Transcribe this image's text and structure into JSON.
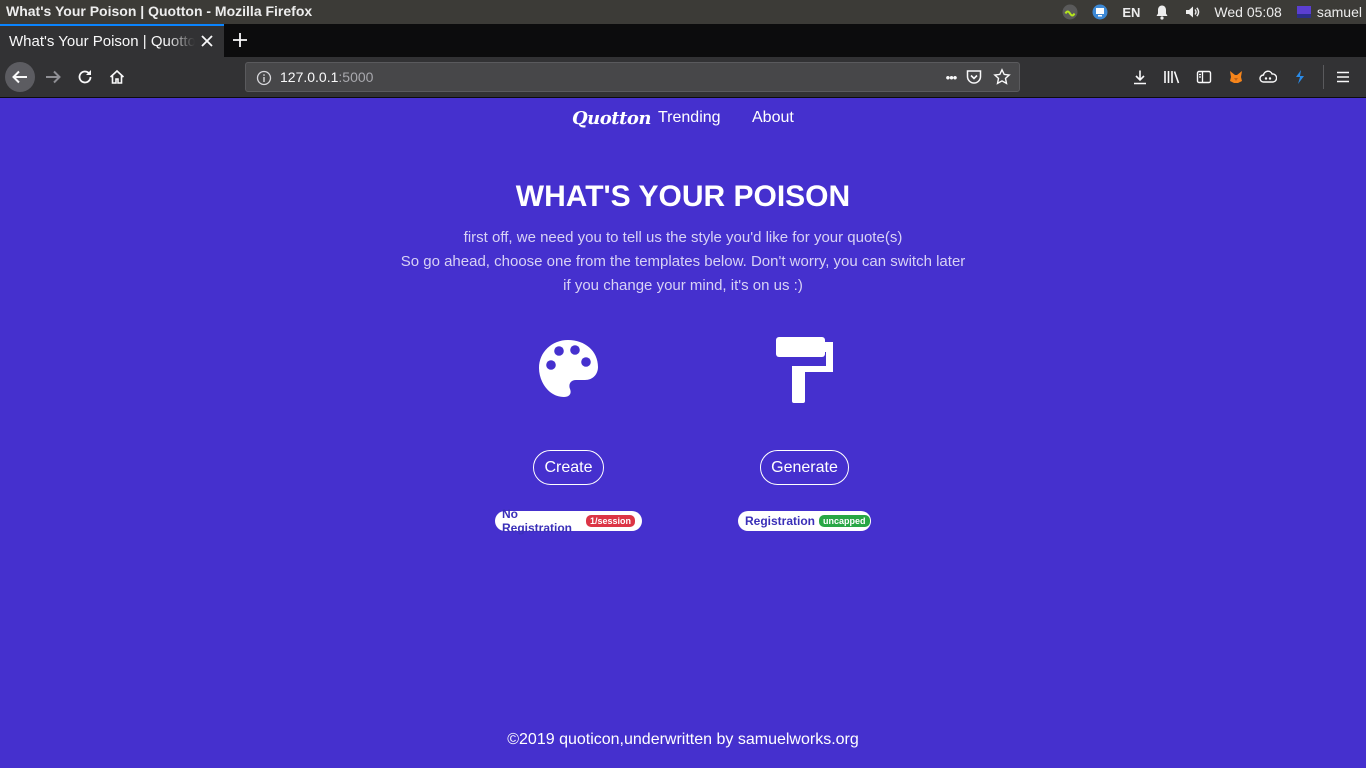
{
  "system": {
    "window_title": "What's Your Poison | Quotton - Mozilla Firefox",
    "language": "EN",
    "clock": "Wed 05:08",
    "user": "samuel"
  },
  "browser": {
    "tab_title": "What's Your Poison | Quotton",
    "url_host": "127.0.0.1",
    "url_port": ":5000",
    "more_label": "•••"
  },
  "site": {
    "logo": "Quotton",
    "nav": {
      "trending": "Trending",
      "about": "About"
    },
    "headline": "WHAT'S YOUR POISON",
    "subtitle": {
      "line1": "first off, we need you to tell us the style you'd like for your quote(s)",
      "line2": "So go ahead, choose one from the templates below. Don't worry, you can switch later",
      "line3": "if you change your mind, it's on us :)"
    },
    "options": {
      "create": {
        "icon": "palette-icon",
        "button": "Create",
        "badge": "No Registration",
        "tag": "1/session",
        "tag_color": "#dc3545"
      },
      "generate": {
        "icon": "paint-roller-icon",
        "button": "Generate",
        "badge": "Registration",
        "tag": "uncapped",
        "tag_color": "#28a745"
      }
    },
    "footer": "©2019 quoticon,underwritten by samuelworks.org",
    "background_color": "#4530ce"
  }
}
